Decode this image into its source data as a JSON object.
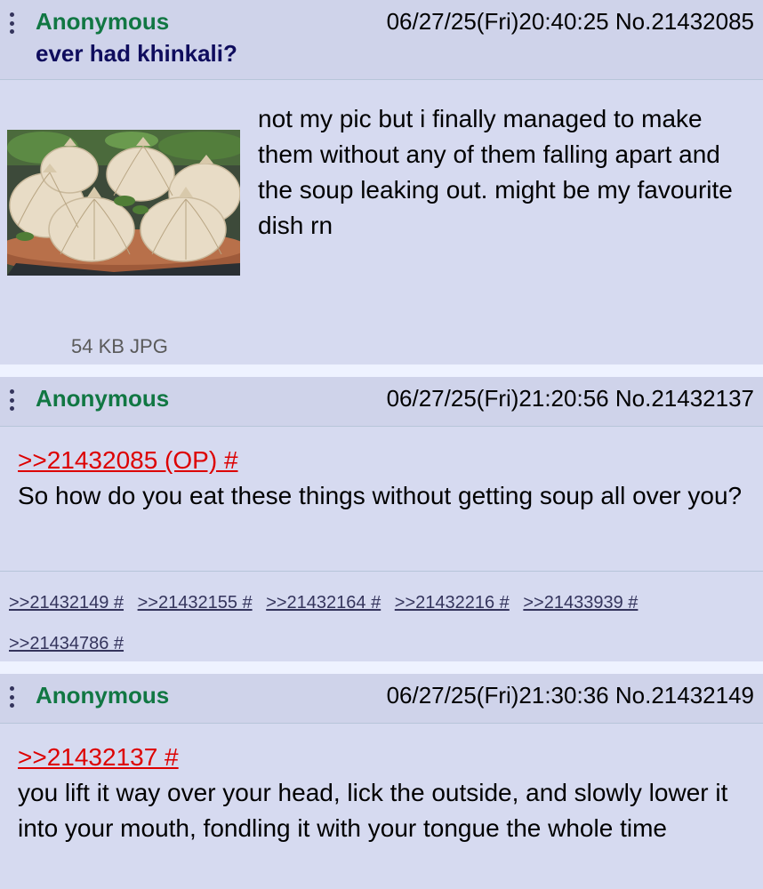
{
  "posts": [
    {
      "name": "Anonymous",
      "datetime": "06/27/25(Fri)20:40:25",
      "number": "No.21432085",
      "subject": "ever had khinkali?",
      "body": "not my pic but i finally managed to make them without any of them falling apart and the soup leaking out. might be my favourite dish rn",
      "file_info": "54 KB JPG",
      "image_desc": "khinkali-dumplings-photo"
    },
    {
      "name": "Anonymous",
      "datetime": "06/27/25(Fri)21:20:56",
      "number": "No.21432137",
      "quote": ">>21432085 (OP) #",
      "body": "So how do you eat these things without getting soup all over you?",
      "replies": [
        ">>21432149 #",
        ">>21432155 #",
        ">>21432164 #",
        ">>21432216 #",
        ">>21433939 #",
        ">>21434786 #"
      ]
    },
    {
      "name": "Anonymous",
      "datetime": "06/27/25(Fri)21:30:36",
      "number": "No.21432149",
      "quote": ">>21432137 #",
      "body": "you lift it way over your head, lick the outside, and slowly lower it into your mouth, fondling it with your tongue the whole time"
    }
  ],
  "colors": {
    "name": "#117743",
    "subject": "#0f0c5d",
    "quotelink": "#dd0000",
    "post_bg": "#d6daf0",
    "page_bg": "#eef2ff"
  },
  "icons": [
    "more-vertical-icon"
  ]
}
